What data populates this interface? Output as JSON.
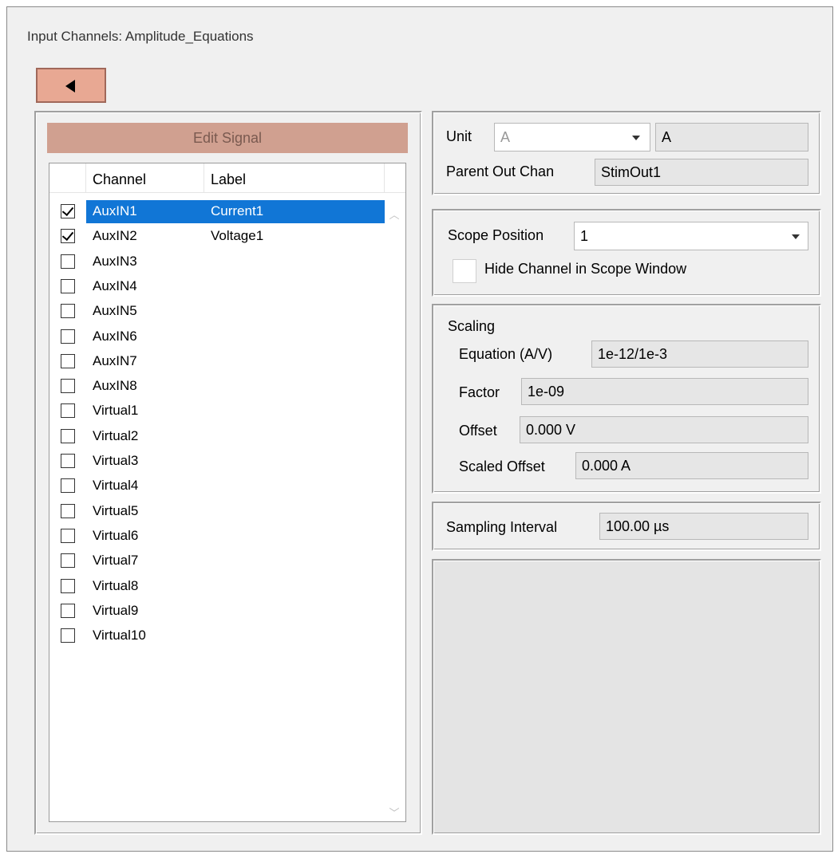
{
  "window": {
    "title": "Input Channels: Amplitude_Equations"
  },
  "toolbar": {
    "back_icon": "left-triangle-icon"
  },
  "left_panel": {
    "edit_signal_label": "Edit Signal",
    "columns": [
      "Channel",
      "Label"
    ],
    "rows": [
      {
        "channel": "AuxIN1",
        "label": "Current1",
        "checked": true,
        "selected": true
      },
      {
        "channel": "AuxIN2",
        "label": "Voltage1",
        "checked": true,
        "selected": false
      },
      {
        "channel": "AuxIN3",
        "label": "",
        "checked": false,
        "selected": false
      },
      {
        "channel": "AuxIN4",
        "label": "",
        "checked": false,
        "selected": false
      },
      {
        "channel": "AuxIN5",
        "label": "",
        "checked": false,
        "selected": false
      },
      {
        "channel": "AuxIN6",
        "label": "",
        "checked": false,
        "selected": false
      },
      {
        "channel": "AuxIN7",
        "label": "",
        "checked": false,
        "selected": false
      },
      {
        "channel": "AuxIN8",
        "label": "",
        "checked": false,
        "selected": false
      },
      {
        "channel": "Virtual1",
        "label": "",
        "checked": false,
        "selected": false
      },
      {
        "channel": "Virtual2",
        "label": "",
        "checked": false,
        "selected": false
      },
      {
        "channel": "Virtual3",
        "label": "",
        "checked": false,
        "selected": false
      },
      {
        "channel": "Virtual4",
        "label": "",
        "checked": false,
        "selected": false
      },
      {
        "channel": "Virtual5",
        "label": "",
        "checked": false,
        "selected": false
      },
      {
        "channel": "Virtual6",
        "label": "",
        "checked": false,
        "selected": false
      },
      {
        "channel": "Virtual7",
        "label": "",
        "checked": false,
        "selected": false
      },
      {
        "channel": "Virtual8",
        "label": "",
        "checked": false,
        "selected": false
      },
      {
        "channel": "Virtual9",
        "label": "",
        "checked": false,
        "selected": false
      },
      {
        "channel": "Virtual10",
        "label": "",
        "checked": false,
        "selected": false
      }
    ],
    "scroll_up_glyph": "︿",
    "scroll_down_glyph": "﹀"
  },
  "unit_group": {
    "unit_label": "Unit",
    "unit_value": "A",
    "unit_text": "A",
    "parent_label": "Parent Out Chan",
    "parent_value": "StimOut1"
  },
  "scope_group": {
    "position_label": "Scope Position",
    "position_value": "1",
    "hide_label": "Hide Channel in Scope Window",
    "hide_checked": false
  },
  "scaling_group": {
    "title": "Scaling",
    "equation_label": "Equation (A/V)",
    "equation_value": "1e-12/1e-3",
    "factor_label": "Factor",
    "factor_value": "1e-09",
    "offset_label": "Offset",
    "offset_value": "0.000 V",
    "scaled_offset_label": "Scaled Offset",
    "scaled_offset_value": "0.000 A"
  },
  "sampling_group": {
    "label": "Sampling Interval",
    "value": "100.00 µs"
  },
  "colors": {
    "accent_button": "#e8a893",
    "edit_signal_bar": "#d0a090",
    "selection": "#1176d6"
  }
}
